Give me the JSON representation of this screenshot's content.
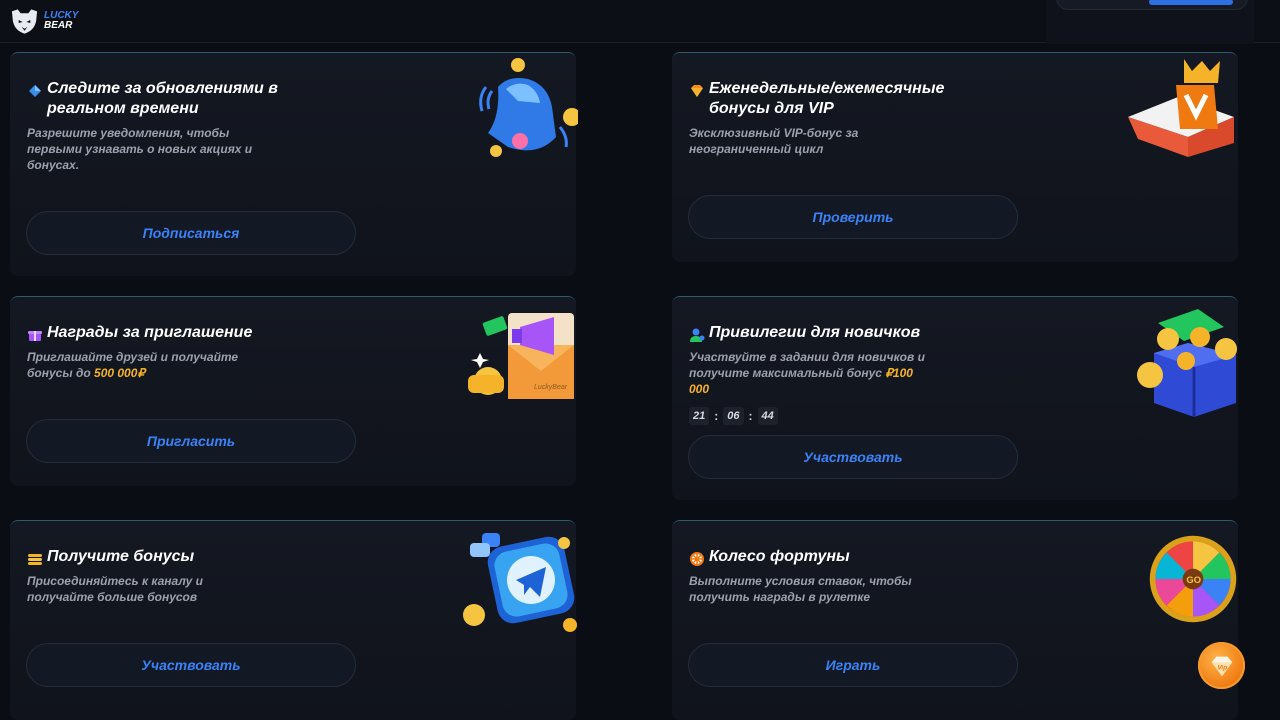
{
  "header": {
    "logo_line1": "LUCKY",
    "logo_line2": "BEAR"
  },
  "cards": [
    {
      "title": "Следите за обновлениями в реальном времени",
      "description": "Разрешите уведомления, чтобы первыми узнавать о новых акциях и бонусах.",
      "button": "Подписаться",
      "icon": "diamond-blue-icon",
      "art": "bell-icon"
    },
    {
      "title": "Еженедельные/ежемесячные бонусы для VIP",
      "description": "Эксклюзивный VIP-бонус за неограниченный цикл",
      "button": "Проверить",
      "icon": "diamond-orange-icon",
      "art": "vip-gift-icon"
    },
    {
      "title": "Награды за приглашение",
      "description_prefix": "Приглашайте друзей и получайте бонусы до ",
      "description_highlight": "500 000₽",
      "button": "Пригласить",
      "icon": "gift-purple-icon",
      "art": "megaphone-icon",
      "art_label": "LuckyBear"
    },
    {
      "title": "Привилегии для новичков",
      "description_prefix": "Участвуйте в задании для новичков и получите максимальный бонус ",
      "description_highlight": "₽100 000",
      "timer": [
        "21",
        "06",
        "44"
      ],
      "timer_sep": ":",
      "button": "Участвовать",
      "icon": "user-icon",
      "art": "treasure-box-icon"
    },
    {
      "title": "Получите бонусы",
      "description": "Присоединяйтесь к каналу и получайте больше бонусов",
      "button": "Участвовать",
      "icon": "coins-stack-icon",
      "art": "telegram-icon"
    },
    {
      "title": "Колесо фортуны",
      "description": "Выполните условия ставок, чтобы получить награды в рулетке",
      "button": "Играть",
      "icon": "wheel-icon",
      "art": "fortune-wheel-icon",
      "art_label": "GO"
    }
  ],
  "floating": {
    "vip_label": "Vip",
    "icon": "vip-diamond-icon"
  },
  "colors": {
    "accent_blue": "#3b82f6",
    "highlight_gold": "#f5b32a",
    "card_bg": "#141822",
    "page_bg": "#0a0d14"
  }
}
